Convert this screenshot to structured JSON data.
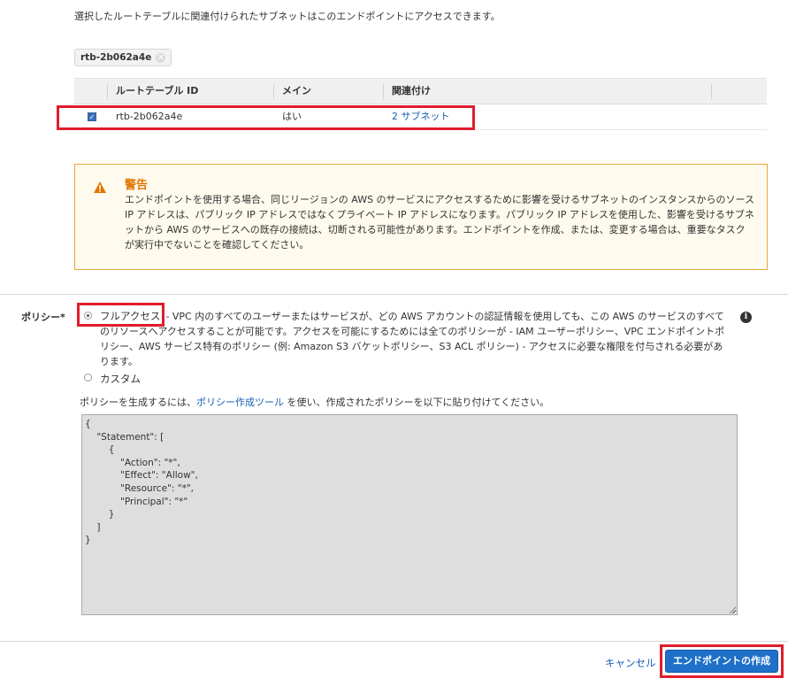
{
  "description": "選択したルートテーブルに関連付けられたサブネットはこのエンドポイントにアクセスできます。",
  "selected_token": {
    "label": "rtb-2b062a4e",
    "remove_icon": "close-icon"
  },
  "route_table": {
    "columns": [
      "ルートテーブル ID",
      "メイン",
      "関連付け"
    ],
    "rows": [
      {
        "checked": true,
        "id": "rtb-2b062a4e",
        "main": "はい",
        "associations": "2 サブネット"
      }
    ]
  },
  "warning": {
    "icon": "warning-icon",
    "title": "警告",
    "body": "エンドポイントを使用する場合、同じリージョンの AWS のサービスにアクセスするために影響を受けるサブネットのインスタンスからのソース IP アドレスは、パブリック IP アドレスではなくプライベート IP アドレスになります。パブリック IP アドレスを使用した、影響を受けるサブネットから AWS のサービスへの既存の接続は、切断される可能性があります。エンドポイントを作成、または、変更する場合は、重要なタスクが実行中でないことを確認してください。"
  },
  "policy": {
    "label": "ポリシー*",
    "options": [
      {
        "label": "フルアクセス",
        "selected": true,
        "description": "- VPC 内のすべてのユーザーまたはサービスが、どの AWS アカウントの認証情報を使用しても、この AWS のサービスのすべてのリソースへアクセスすることが可能です。アクセスを可能にするためには全てのポリシーが - IAM ユーザーポリシー、VPC エンドポイントポリシー、AWS サービス特有のポリシー (例: Amazon S3 バケットポリシー、S3 ACL ポリシー) - アクセスに必要な権限を付与される必要があります。"
      },
      {
        "label": "カスタム",
        "selected": false
      }
    ],
    "generator_prefix": "ポリシーを生成するには、",
    "generator_link": "ポリシー作成ツール",
    "generator_suffix": " を使い、作成されたポリシーを以下に貼り付けてください。",
    "document": "{\n    \"Statement\": [\n        {\n            \"Action\": \"*\",\n            \"Effect\": \"Allow\",\n            \"Resource\": \"*\",\n            \"Principal\": \"*\"\n        }\n    ]\n}"
  },
  "actions": {
    "cancel": "キャンセル",
    "create": "エンドポイントの作成"
  },
  "colors": {
    "link": "#1a5fb4",
    "primary": "#1f70c8",
    "warning_border": "#e6a838",
    "highlight": "#e01d2c"
  }
}
